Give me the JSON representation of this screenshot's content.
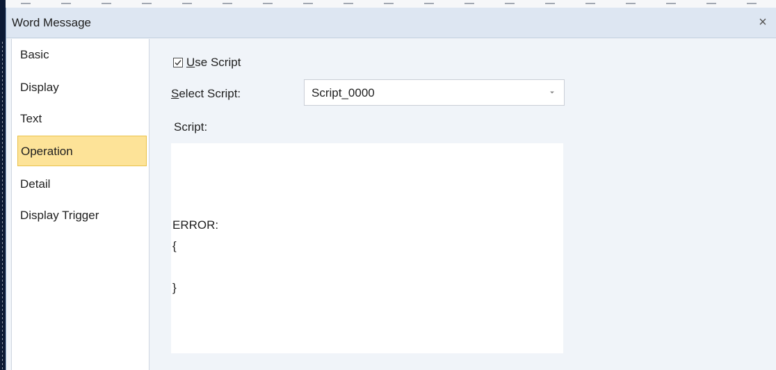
{
  "dialog": {
    "title": "Word Message",
    "close_glyph": "×"
  },
  "nav": {
    "items": [
      {
        "label": "Basic"
      },
      {
        "label": "Display"
      },
      {
        "label": "Text"
      },
      {
        "label": "Operation",
        "selected": true
      },
      {
        "label": "Detail"
      },
      {
        "label": "Display Trigger"
      }
    ]
  },
  "operation": {
    "use_script": {
      "checked": true,
      "label_accel": "U",
      "label_rest": "se Script"
    },
    "select_script": {
      "label_accel": "S",
      "label_rest": "elect Script:",
      "value": "Script_0000"
    },
    "script": {
      "label": "Script:",
      "lines": [
        "ERROR:",
        "{",
        "}"
      ]
    }
  },
  "colors": {
    "selected_bg": "#fde398",
    "selected_border": "#e9c24a",
    "titlebar_bg": "#dde6f2",
    "dialog_bg": "#f0f4f9"
  }
}
